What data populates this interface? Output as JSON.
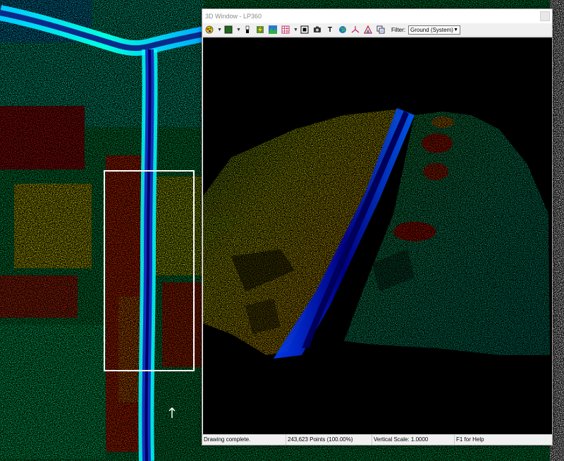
{
  "window": {
    "title": "3D Window - LP360"
  },
  "toolbar": {
    "filter_label": "Filter:",
    "filter_value": "Ground (System)",
    "icons": [
      "color-palette-icon",
      "display-mode-icon",
      "scale-bar-icon",
      "bolt-icon",
      "terrain-icon",
      "grid-icon",
      "fit-extent-icon",
      "camera-icon",
      "text-icon",
      "globe-icon",
      "axis-icon",
      "triangle-icon",
      "copy-icon"
    ],
    "text_icon_glyph": "T"
  },
  "status": {
    "message": "Drawing complete.",
    "points": "243,623 Points (100.00%)",
    "vertical_scale": "Vertical Scale: 1.0000",
    "help": "F1 for Help"
  },
  "colors": {
    "elevation_low": "#0000cc",
    "elevation_mid": "#00cc44",
    "elevation_high": "#ff1a00",
    "selection_box": "#ffffff",
    "window_chrome": "#f0f0f0"
  }
}
